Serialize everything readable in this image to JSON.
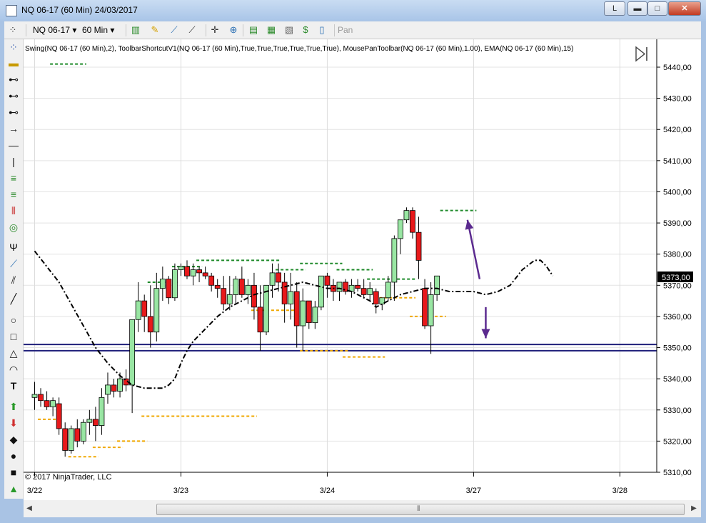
{
  "window": {
    "title": "NQ 06-17 (60 Min)  24/03/2017",
    "btn_l": "L",
    "btn_min": "▬",
    "btn_max": "□",
    "btn_close": "✕"
  },
  "toolbar": {
    "instrument": "NQ 06-17",
    "period": "60 Min",
    "pan": "Pan"
  },
  "indicators_label": "Swing(NQ 06-17 (60 Min),2), ToolbarShortcutV1(NQ 06-17 (60 Min),True,True,True,True,True,True), MousePanToolbar(NQ 06-17 (60 Min),1.00), EMA(NQ 06-17 (60 Min),15)",
  "copyright": "© 2017 NinjaTrader, LLC",
  "price_marker": "5373,00",
  "colors": {
    "up": "#99e6a3",
    "down": "#e8191b",
    "swing_high": "#1f8a2a",
    "swing_low": "#f0a800",
    "hline": "#1f1f7a",
    "arrow": "#5b2a8f"
  },
  "chart_data": {
    "type": "candlestick",
    "y_axis": {
      "ylim": [
        5306,
        5446
      ],
      "ticks": [
        "5440,00",
        "5430,00",
        "5420,00",
        "5410,00",
        "5400,00",
        "5390,00",
        "5380,00",
        "5370,00",
        "5360,00",
        "5350,00",
        "5340,00",
        "5330,00",
        "5320,00",
        "5310,00"
      ],
      "tick_values": [
        5440,
        5430,
        5420,
        5410,
        5400,
        5390,
        5380,
        5370,
        5360,
        5350,
        5340,
        5330,
        5320,
        5310
      ]
    },
    "x_axis": {
      "labels": [
        "3/22",
        "3/23",
        "3/24",
        "3/27",
        "3/28"
      ],
      "label_bar_index": [
        0,
        24,
        48,
        72,
        96
      ]
    },
    "candles": [
      [
        5334,
        5339,
        5330,
        5335
      ],
      [
        5335,
        5337,
        5331,
        5333
      ],
      [
        5333,
        5336,
        5330,
        5331
      ],
      [
        5331,
        5334,
        5328,
        5333
      ],
      [
        5332,
        5334,
        5322,
        5324
      ],
      [
        5324,
        5326,
        5315,
        5317
      ],
      [
        5317,
        5325,
        5316,
        5324
      ],
      [
        5324,
        5327,
        5318,
        5320
      ],
      [
        5320,
        5327,
        5319,
        5326
      ],
      [
        5326,
        5330,
        5322,
        5327
      ],
      [
        5327,
        5331,
        5320,
        5325
      ],
      [
        5325,
        5337,
        5322,
        5334
      ],
      [
        5335,
        5342,
        5332,
        5338
      ],
      [
        5338,
        5340,
        5334,
        5336
      ],
      [
        5336,
        5342,
        5334,
        5340
      ],
      [
        5340,
        5343,
        5336,
        5338
      ],
      [
        5338,
        5359,
        5329,
        5359
      ],
      [
        5359,
        5371,
        5355,
        5365
      ],
      [
        5365,
        5367,
        5355,
        5360
      ],
      [
        5360,
        5370,
        5350,
        5355
      ],
      [
        5355,
        5374,
        5352,
        5369
      ],
      [
        5369,
        5376,
        5365,
        5372
      ],
      [
        5372,
        5373,
        5364,
        5366
      ],
      [
        5366,
        5377,
        5365,
        5375
      ],
      [
        5375,
        5377,
        5373,
        5376
      ],
      [
        5376,
        5378,
        5372,
        5373
      ],
      [
        5373,
        5377,
        5370,
        5375
      ],
      [
        5375,
        5376,
        5371,
        5374
      ],
      [
        5374,
        5376,
        5372,
        5373
      ],
      [
        5373,
        5374,
        5368,
        5370
      ],
      [
        5370,
        5372,
        5366,
        5369
      ],
      [
        5369,
        5373,
        5362,
        5364
      ],
      [
        5364,
        5373,
        5362,
        5367
      ],
      [
        5367,
        5373,
        5364,
        5372
      ],
      [
        5372,
        5376,
        5366,
        5367
      ],
      [
        5367,
        5372,
        5364,
        5370
      ],
      [
        5370,
        5374,
        5359,
        5363
      ],
      [
        5363,
        5370,
        5349,
        5355
      ],
      [
        5355,
        5370,
        5354,
        5370
      ],
      [
        5370,
        5377,
        5366,
        5374
      ],
      [
        5374,
        5377,
        5368,
        5371
      ],
      [
        5371,
        5374,
        5358,
        5364
      ],
      [
        5364,
        5374,
        5359,
        5368
      ],
      [
        5368,
        5371,
        5350,
        5357
      ],
      [
        5357,
        5369,
        5349,
        5365
      ],
      [
        5365,
        5365,
        5356,
        5358
      ],
      [
        5358,
        5365,
        5356,
        5363
      ],
      [
        5363,
        5373,
        5362,
        5373
      ],
      [
        5373,
        5374,
        5366,
        5370
      ],
      [
        5370,
        5372,
        5365,
        5368
      ],
      [
        5368,
        5371,
        5365,
        5371
      ],
      [
        5371,
        5372,
        5367,
        5368
      ],
      [
        5368,
        5372,
        5366,
        5370
      ],
      [
        5370,
        5372,
        5368,
        5369
      ],
      [
        5369,
        5372,
        5366,
        5367
      ],
      [
        5367,
        5371,
        5365,
        5369
      ],
      [
        5368,
        5369,
        5361,
        5364
      ],
      [
        5364,
        5366,
        5362,
        5366
      ],
      [
        5366,
        5373,
        5365,
        5371
      ],
      [
        5371,
        5386,
        5365,
        5385
      ],
      [
        5385,
        5391,
        5380,
        5391
      ],
      [
        5391,
        5395,
        5390,
        5394
      ],
      [
        5394,
        5395,
        5385,
        5387
      ],
      [
        5387,
        5392,
        5372,
        5378
      ],
      [
        5369,
        5372,
        5356,
        5357
      ],
      [
        5357,
        5371,
        5348,
        5367
      ],
      [
        5367,
        5373,
        5365,
        5373
      ]
    ],
    "ema": [
      [
        0,
        5381
      ],
      [
        2,
        5376
      ],
      [
        4,
        5371
      ],
      [
        6,
        5364
      ],
      [
        8,
        5357
      ],
      [
        10,
        5350
      ],
      [
        12,
        5345
      ],
      [
        14,
        5341
      ],
      [
        16,
        5338
      ],
      [
        18,
        5337
      ],
      [
        20,
        5337
      ],
      [
        21,
        5337
      ],
      [
        22,
        5338
      ],
      [
        23,
        5340
      ],
      [
        24,
        5345
      ],
      [
        25,
        5349
      ],
      [
        26,
        5352
      ],
      [
        28,
        5356
      ],
      [
        30,
        5360
      ],
      [
        32,
        5363
      ],
      [
        34,
        5365
      ],
      [
        36,
        5367
      ],
      [
        38,
        5368
      ],
      [
        40,
        5369
      ],
      [
        42,
        5370
      ],
      [
        44,
        5371
      ],
      [
        46,
        5370
      ],
      [
        48,
        5369
      ],
      [
        50,
        5369
      ],
      [
        52,
        5368
      ],
      [
        53,
        5367
      ],
      [
        54,
        5366
      ],
      [
        55,
        5365
      ],
      [
        56,
        5363
      ],
      [
        58,
        5365
      ],
      [
        60,
        5367
      ],
      [
        62,
        5368
      ],
      [
        64,
        5369
      ],
      [
        66,
        5369
      ],
      [
        68,
        5368
      ],
      [
        70,
        5368
      ],
      [
        72,
        5368
      ],
      [
        74,
        5367
      ],
      [
        76,
        5368
      ],
      [
        78,
        5370
      ],
      [
        80,
        5375
      ],
      [
        82,
        5378
      ],
      [
        83,
        5378
      ],
      [
        84,
        5376
      ],
      [
        85,
        5373
      ]
    ],
    "swing_highs": [
      [
        3,
        8,
        5441
      ],
      [
        19,
        23,
        5371
      ],
      [
        23,
        27,
        5376
      ],
      [
        27,
        40,
        5378
      ],
      [
        40,
        44,
        5375
      ],
      [
        44,
        50,
        5377
      ],
      [
        50,
        55,
        5375
      ],
      [
        55,
        62,
        5372
      ],
      [
        67,
        72,
        5394
      ]
    ],
    "swing_lows": [
      [
        1,
        4,
        5327
      ],
      [
        6,
        10,
        5315
      ],
      [
        10,
        14,
        5318
      ],
      [
        14,
        18,
        5320
      ],
      [
        18,
        36,
        5328
      ],
      [
        36,
        44,
        5362
      ],
      [
        44,
        51,
        5349
      ],
      [
        51,
        57,
        5347
      ],
      [
        57,
        62,
        5366
      ],
      [
        62,
        67,
        5360
      ]
    ],
    "hlines": [
      5351,
      5349
    ],
    "arrows": [
      {
        "from": [
          73,
          5372
        ],
        "to": [
          71,
          5391
        ]
      },
      {
        "from": [
          74,
          5363
        ],
        "to": [
          74,
          5353
        ]
      }
    ]
  }
}
